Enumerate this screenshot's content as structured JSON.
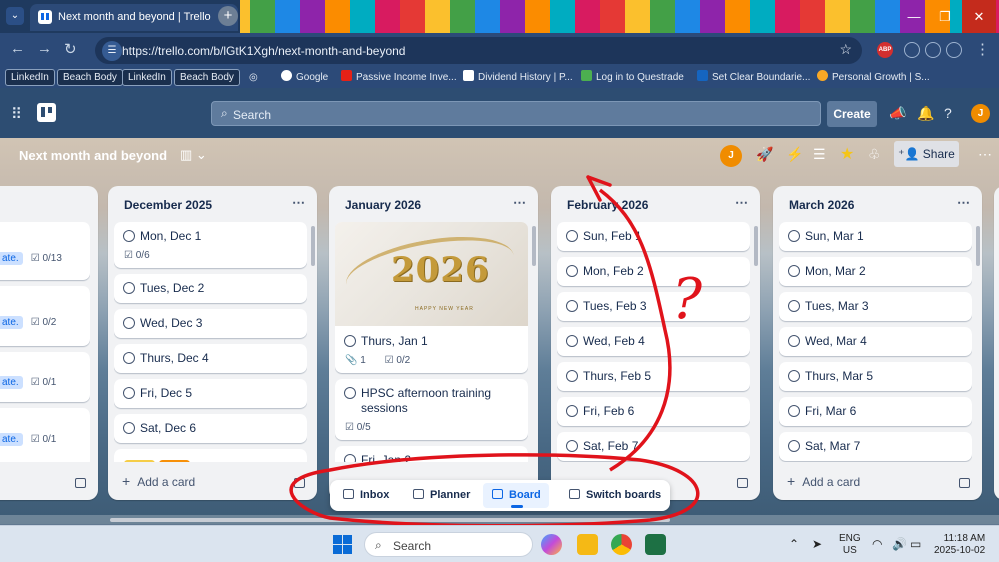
{
  "browser": {
    "tab_title": "Next month and beyond | Trello",
    "tab_close": "✕",
    "new_tab": "+",
    "url": "https://trello.com/b/lGtK1Xgh/next-month-and-beyond",
    "controls": {
      "minimize": "—",
      "maximize": "❐",
      "close": "✕"
    },
    "bookmarks": [
      "LinkedIn",
      "Beach Body",
      "LinkedIn",
      "Beach Body",
      "Google",
      "Passive Income Inve...",
      "Dividend History | P...",
      "Log in to Questrade",
      "Set Clear Boundarie...",
      "Personal Growth | S..."
    ],
    "ext_label": "ABP"
  },
  "trello": {
    "search_placeholder": "Search",
    "create_label": "Create",
    "avatar_initial": "J"
  },
  "board": {
    "title": "Next month and beyond",
    "view_glyph": "▥ ⌄",
    "share_label": "Share",
    "avatar_initial": "J",
    "add_card_label": "Add a card",
    "lists": [
      {
        "title": "",
        "cards": [
          {
            "pill": "ate.",
            "checklist": "0/13"
          },
          {
            "pill": "ate.",
            "checklist": "0/2"
          },
          {
            "pill": "ate.",
            "checklist": "0/1"
          },
          {
            "pill": "ate.",
            "checklist": "0/1"
          }
        ]
      },
      {
        "title": "December 2025",
        "cards": [
          {
            "name": "Mon, Dec 1",
            "checklist": "0/6"
          },
          {
            "name": "Tues, Dec 2"
          },
          {
            "name": "Wed, Dec 3"
          },
          {
            "name": "Thurs, Dec 4"
          },
          {
            "name": "Fri, Dec 5"
          },
          {
            "name": "Sat, Dec 6"
          }
        ]
      },
      {
        "title": "January 2026",
        "cover_text": "2026",
        "cover_subtext": "HAPPY NEW YEAR",
        "cards": [
          {
            "name": "Thurs, Jan 1",
            "attachments": "1",
            "checklist": "0/2"
          },
          {
            "name": "HPSC afternoon training sessions",
            "checklist": "0/5"
          },
          {
            "name": "Fri, Jan 2"
          }
        ]
      },
      {
        "title": "February 2026",
        "cards": [
          {
            "name": "Sun, Feb 1"
          },
          {
            "name": "Mon, Feb 2"
          },
          {
            "name": "Tues, Feb 3"
          },
          {
            "name": "Wed, Feb 4"
          },
          {
            "name": "Thurs, Feb 5"
          },
          {
            "name": "Fri, Feb 6"
          },
          {
            "name": "Sat, Feb 7"
          }
        ]
      },
      {
        "title": "March 2026",
        "cards": [
          {
            "name": "Sun, Mar 1"
          },
          {
            "name": "Mon, Mar 2"
          },
          {
            "name": "Tues, Mar 3"
          },
          {
            "name": "Wed, Mar 4"
          },
          {
            "name": "Thurs, Mar 5"
          },
          {
            "name": "Fri, Mar 6"
          },
          {
            "name": "Sat, Mar 7"
          }
        ]
      }
    ],
    "switcher": {
      "inbox": "Inbox",
      "planner": "Planner",
      "board": "Board",
      "switch_boards": "Switch boards"
    }
  },
  "annotation": {
    "text": "?",
    "color": "#e0131b"
  },
  "taskbar": {
    "search_placeholder": "Search",
    "lang_line1": "ENG",
    "lang_line2": "US",
    "time": "11:18 AM",
    "date": "2025-10-02"
  },
  "colors": {
    "accent": "#0c66e4",
    "label_yellow": "#f5cd47",
    "label_orange": "#f79008"
  }
}
